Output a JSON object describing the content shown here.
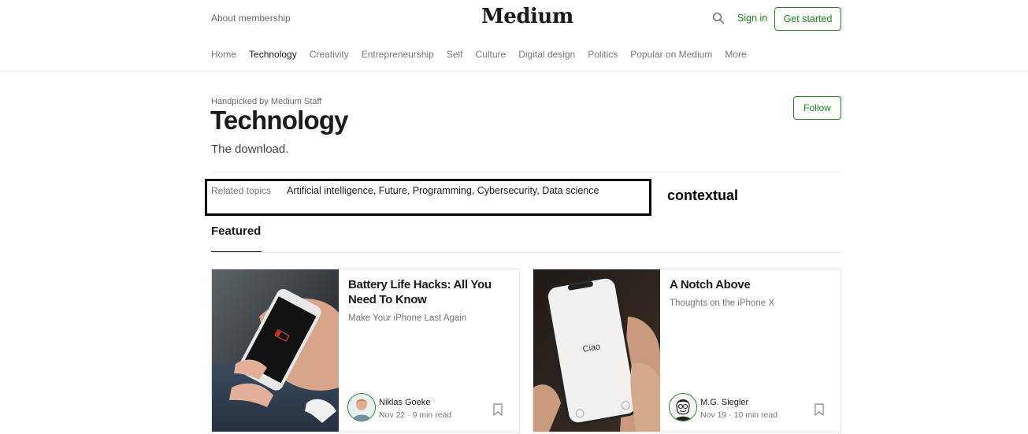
{
  "header": {
    "left_link": "About membership",
    "logo": "Medium",
    "search_icon": "search-icon",
    "sign_in": "Sign in",
    "get_started": "Get started"
  },
  "nav": {
    "items": [
      "Home",
      "Technology",
      "Creativity",
      "Entrepreneurship",
      "Self",
      "Culture",
      "Digital design",
      "Politics",
      "Popular on Medium",
      "More"
    ],
    "active": "Technology"
  },
  "topic": {
    "handpicked": "Handpicked by Medium Staff",
    "title": "Technology",
    "subtitle": "The download.",
    "follow": "Follow"
  },
  "related": {
    "label": "Related topics",
    "topics": "Artificial intelligence, Future, Programming, Cybersecurity, Data science",
    "annotation": "contextual"
  },
  "featured": {
    "heading": "Featured",
    "cards": [
      {
        "title": "Battery Life Hacks: All You Need To Know",
        "subtitle": "Make Your iPhone Last Again",
        "author": "Niklas Goeke",
        "meta": "Nov 22 · 9 min read",
        "image_icon": "phone-low-battery-image"
      },
      {
        "title": "A Notch Above",
        "subtitle": "Thoughts on the iPhone X",
        "author": "M.G. Siegler",
        "meta": "Nov 19 · 10 min read",
        "image_icon": "iphone-x-image",
        "phone_text": "Ciao"
      }
    ]
  },
  "colors": {
    "accent": "#1a8917",
    "text": "#1a1a1a",
    "muted": "#757575",
    "divider": "#f0f0f0"
  }
}
